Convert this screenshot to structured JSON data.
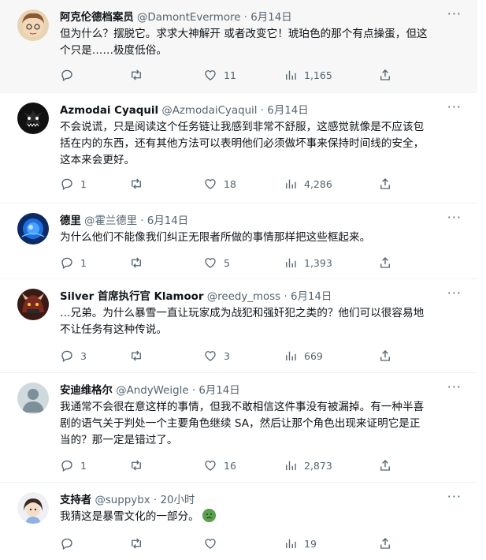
{
  "tweets": [
    {
      "name": "阿克伦德档案员",
      "handle": "@DamontEvermore",
      "dot": "·",
      "date": "6月14日",
      "text_lines": [
        "但为什么？摆脱它。求求大神解开 或者改变它！琥珀色的那个有点操蛋，但这",
        "个只是……极度低俗。"
      ],
      "reply_count": "",
      "retweet_count": "",
      "like_count": "11",
      "view_count": "1,165",
      "more": "···"
    },
    {
      "name": "Azmodai Cyaquil",
      "handle": "@AzmodaiCyaquil",
      "dot": "·",
      "date": "6月14日",
      "text_lines": [
        "不会说谎，只是阅读这个任务链让我感到非常不舒服，这感觉就像是不应该包",
        "括在内的东西，还有其他方法可以表明他们必须做坏事来保持时间线的安全，",
        "这本来会更好。"
      ],
      "reply_count": "1",
      "retweet_count": "",
      "like_count": "18",
      "view_count": "4,286",
      "more": "···"
    },
    {
      "name": "德里",
      "handle": "@霍兰德里",
      "dot": "·",
      "date": "6月14日",
      "text_lines": [
        "为什么他们不能像我们纠正无限者所做的事情那样把这些框起来。"
      ],
      "reply_count": "1",
      "retweet_count": "",
      "like_count": "5",
      "view_count": "1,393",
      "more": "···"
    },
    {
      "name": "Silver 首席执行官 Klamoor",
      "handle": "@reedy_moss",
      "dot": "·",
      "date": "6月14日",
      "text_lines": [
        "…兄弟。为什么暴雪一直让玩家成为战犯和强奸犯之类的？他们可以很容易地",
        "不让任务有这种传说。"
      ],
      "reply_count": "3",
      "retweet_count": "",
      "like_count": "3",
      "view_count": "669",
      "more": "···"
    },
    {
      "name": "安迪维格尔",
      "handle": "@AndyWeigle",
      "dot": "·",
      "date": "6月14日",
      "text_lines": [
        "我通常不会很在意这样的事情，但我不敢相信这件事没有被漏掉。有一种半喜",
        "剧的语气关于判处一个主要角色继续 SA，然后让那个角色出现来证明它是正",
        "当的？那一定是错过了。"
      ],
      "reply_count": "1",
      "retweet_count": "",
      "like_count": "16",
      "view_count": "2,873",
      "more": "···"
    },
    {
      "name": "支持者",
      "handle": "@suppybx",
      "dot": "·",
      "date": "20小时",
      "text_lines": [
        "我猜这是暴雪文化的一部分。"
      ],
      "reply_count": "",
      "retweet_count": "",
      "like_count": "",
      "view_count": "19",
      "more": "···"
    }
  ],
  "icons": {
    "reply": "reply-icon",
    "retweet": "retweet-icon",
    "like": "heart-icon",
    "views": "views-icon",
    "share": "share-icon"
  },
  "colors": {
    "text": "#0f1419",
    "secondary": "#536471",
    "divider": "#eff3f4"
  }
}
